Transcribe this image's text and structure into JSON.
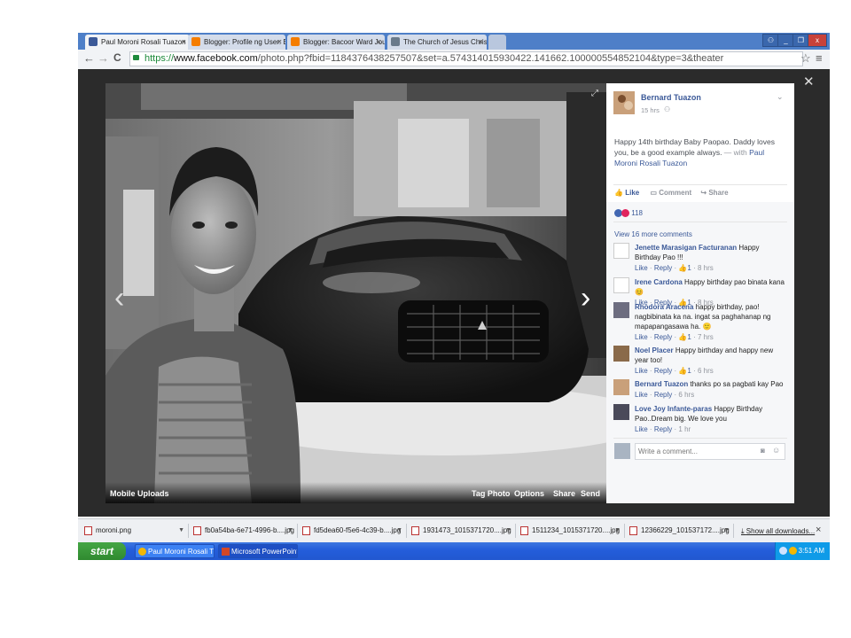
{
  "browser": {
    "tabs": [
      {
        "title": "Paul Moroni Rosali Tuazon",
        "close": "×",
        "favicon_color": "#3b5998"
      },
      {
        "title": "Blogger: Profile ng User: Ba",
        "close": "×",
        "favicon_color": "#f57d00"
      },
      {
        "title": "Blogger: Bacoor Ward Journ",
        "close": "×",
        "favicon_color": "#f57d00"
      },
      {
        "title": "The Church of Jesus Christ o",
        "close": "×",
        "favicon_color": "#6a7a8a"
      }
    ],
    "url_scheme": "https://",
    "url_domain": "www.facebook.com",
    "url_path": "/photo.php?fbid=1184376438257507&set=a.574314015930422.141662.100000554852104&type=3&theater",
    "back": "←",
    "forward": "→",
    "reload": "C",
    "star": "☆",
    "menu": "≡",
    "win_min": "_",
    "win_max": "❐",
    "win_close": "x",
    "win_user": "⚇"
  },
  "photo": {
    "album": "Mobile Uploads",
    "actions": {
      "tag": "Tag Photo",
      "options": "Options",
      "share": "Share",
      "send": "Send"
    },
    "prev": "‹",
    "next": "›",
    "close": "✕"
  },
  "post": {
    "author": "Bernard Tuazon",
    "time": "15 hrs",
    "text": "Happy 14th birthday Baby Paopao. Daddy loves you, be a good example always.",
    "with_prefix": " — with ",
    "tagged": "Paul Moroni Rosali Tuazon",
    "actions": {
      "like": "Like",
      "comment": "Comment",
      "share": "Share"
    },
    "reaction_count": "118",
    "view_more": "View 16 more comments",
    "comment_placeholder": "Write a comment..."
  },
  "comments": [
    {
      "name": "Jenette Marasigan Facturanan",
      "text": "Happy Birthday Pao !!!",
      "likes": "1",
      "time": "8 hrs",
      "has_likes": true
    },
    {
      "name": "Irene Cardona",
      "text": "Happy birthday pao binata kana",
      "emoji": "😊",
      "likes": "1",
      "time": "8 hrs",
      "has_likes": true
    },
    {
      "name": "Rhodora Aracena",
      "text": "happy birthday, pao! nagbibinata ka na. ingat sa paghahanap ng mapapangasawa ha.",
      "emoji": "🙂",
      "likes": "1",
      "time": "7 hrs",
      "has_likes": true
    },
    {
      "name": "Noel Placer",
      "text": "Happy birthday and happy new year too!",
      "likes": "1",
      "time": "6 hrs",
      "has_likes": true
    },
    {
      "name": "Bernard Tuazon",
      "text": "thanks po sa pagbati kay Pao",
      "time": "6 hrs",
      "has_likes": false
    },
    {
      "name": "Love Joy Infante-paras",
      "text": "Happy Birthday Pao..Dream big. We love you",
      "time": "1 hr",
      "has_likes": false
    }
  ],
  "comment_actions": {
    "like": "Like",
    "reply": "Reply",
    "sep": "·"
  },
  "downloads": {
    "items": [
      "moroni.png",
      "fb0a54ba-6e71-4996-b....jpg",
      "fd5dea60-f5e6-4c39-b....jpg",
      "1931473_1015371720....jpg",
      "1511234_1015371720....jpg",
      "12366229_101537172....jpg"
    ],
    "show_all": "Show all downloads...",
    "close": "×"
  },
  "taskbar": {
    "start": "start",
    "tasks": [
      "Paul Moroni Rosali Tu...",
      "Microsoft PowerPoint ..."
    ],
    "clock": "3:51 AM"
  }
}
